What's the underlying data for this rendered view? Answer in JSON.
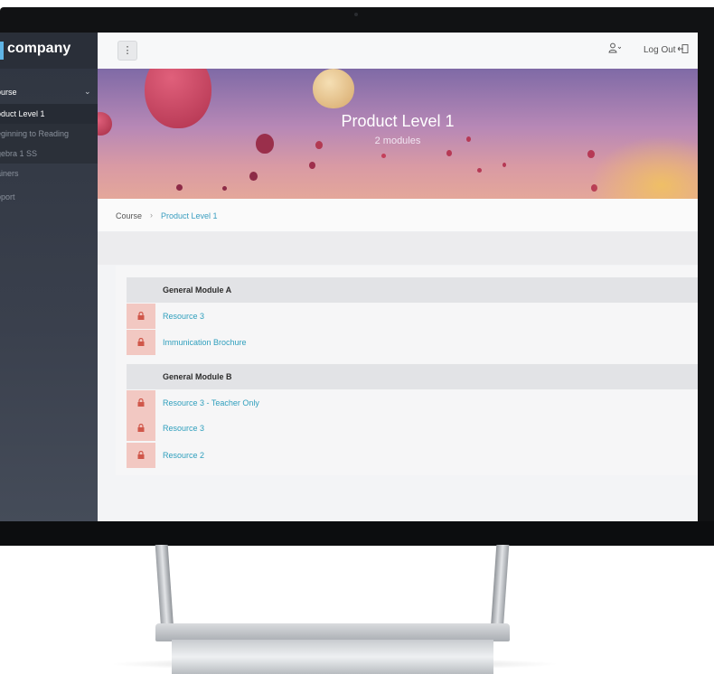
{
  "brand": {
    "name": "company"
  },
  "sidebar": {
    "section_label": "ourse",
    "items": [
      {
        "label": "oduct Level 1",
        "active": true
      },
      {
        "label": "eginning to Reading",
        "active": false
      },
      {
        "label": "gebra 1 SS",
        "active": false
      },
      {
        "label": "ainers",
        "active": false
      },
      {
        "label": "pport",
        "active": false
      }
    ]
  },
  "topbar": {
    "menu_icon": "vertical-dots-icon",
    "user_icon": "user-icon",
    "logout_label": "Log Out"
  },
  "hero": {
    "title": "Product Level 1",
    "subtitle": "2 modules"
  },
  "breadcrumb": {
    "home": "Course",
    "separator": "›",
    "current": "Product Level 1"
  },
  "modules": [
    {
      "title": "General Module A",
      "resources": [
        "Resource 3",
        "Immunication Brochure"
      ]
    },
    {
      "title": "General Module B",
      "resources": [
        "Resource 3 - Teacher Only",
        "Resource 3",
        "Resource 2"
      ]
    }
  ],
  "colors": {
    "link": "#2f9fbd",
    "lock_bg": "#f2c8c2",
    "sidebar": "#353b47",
    "accent": "#5fb4e6"
  }
}
